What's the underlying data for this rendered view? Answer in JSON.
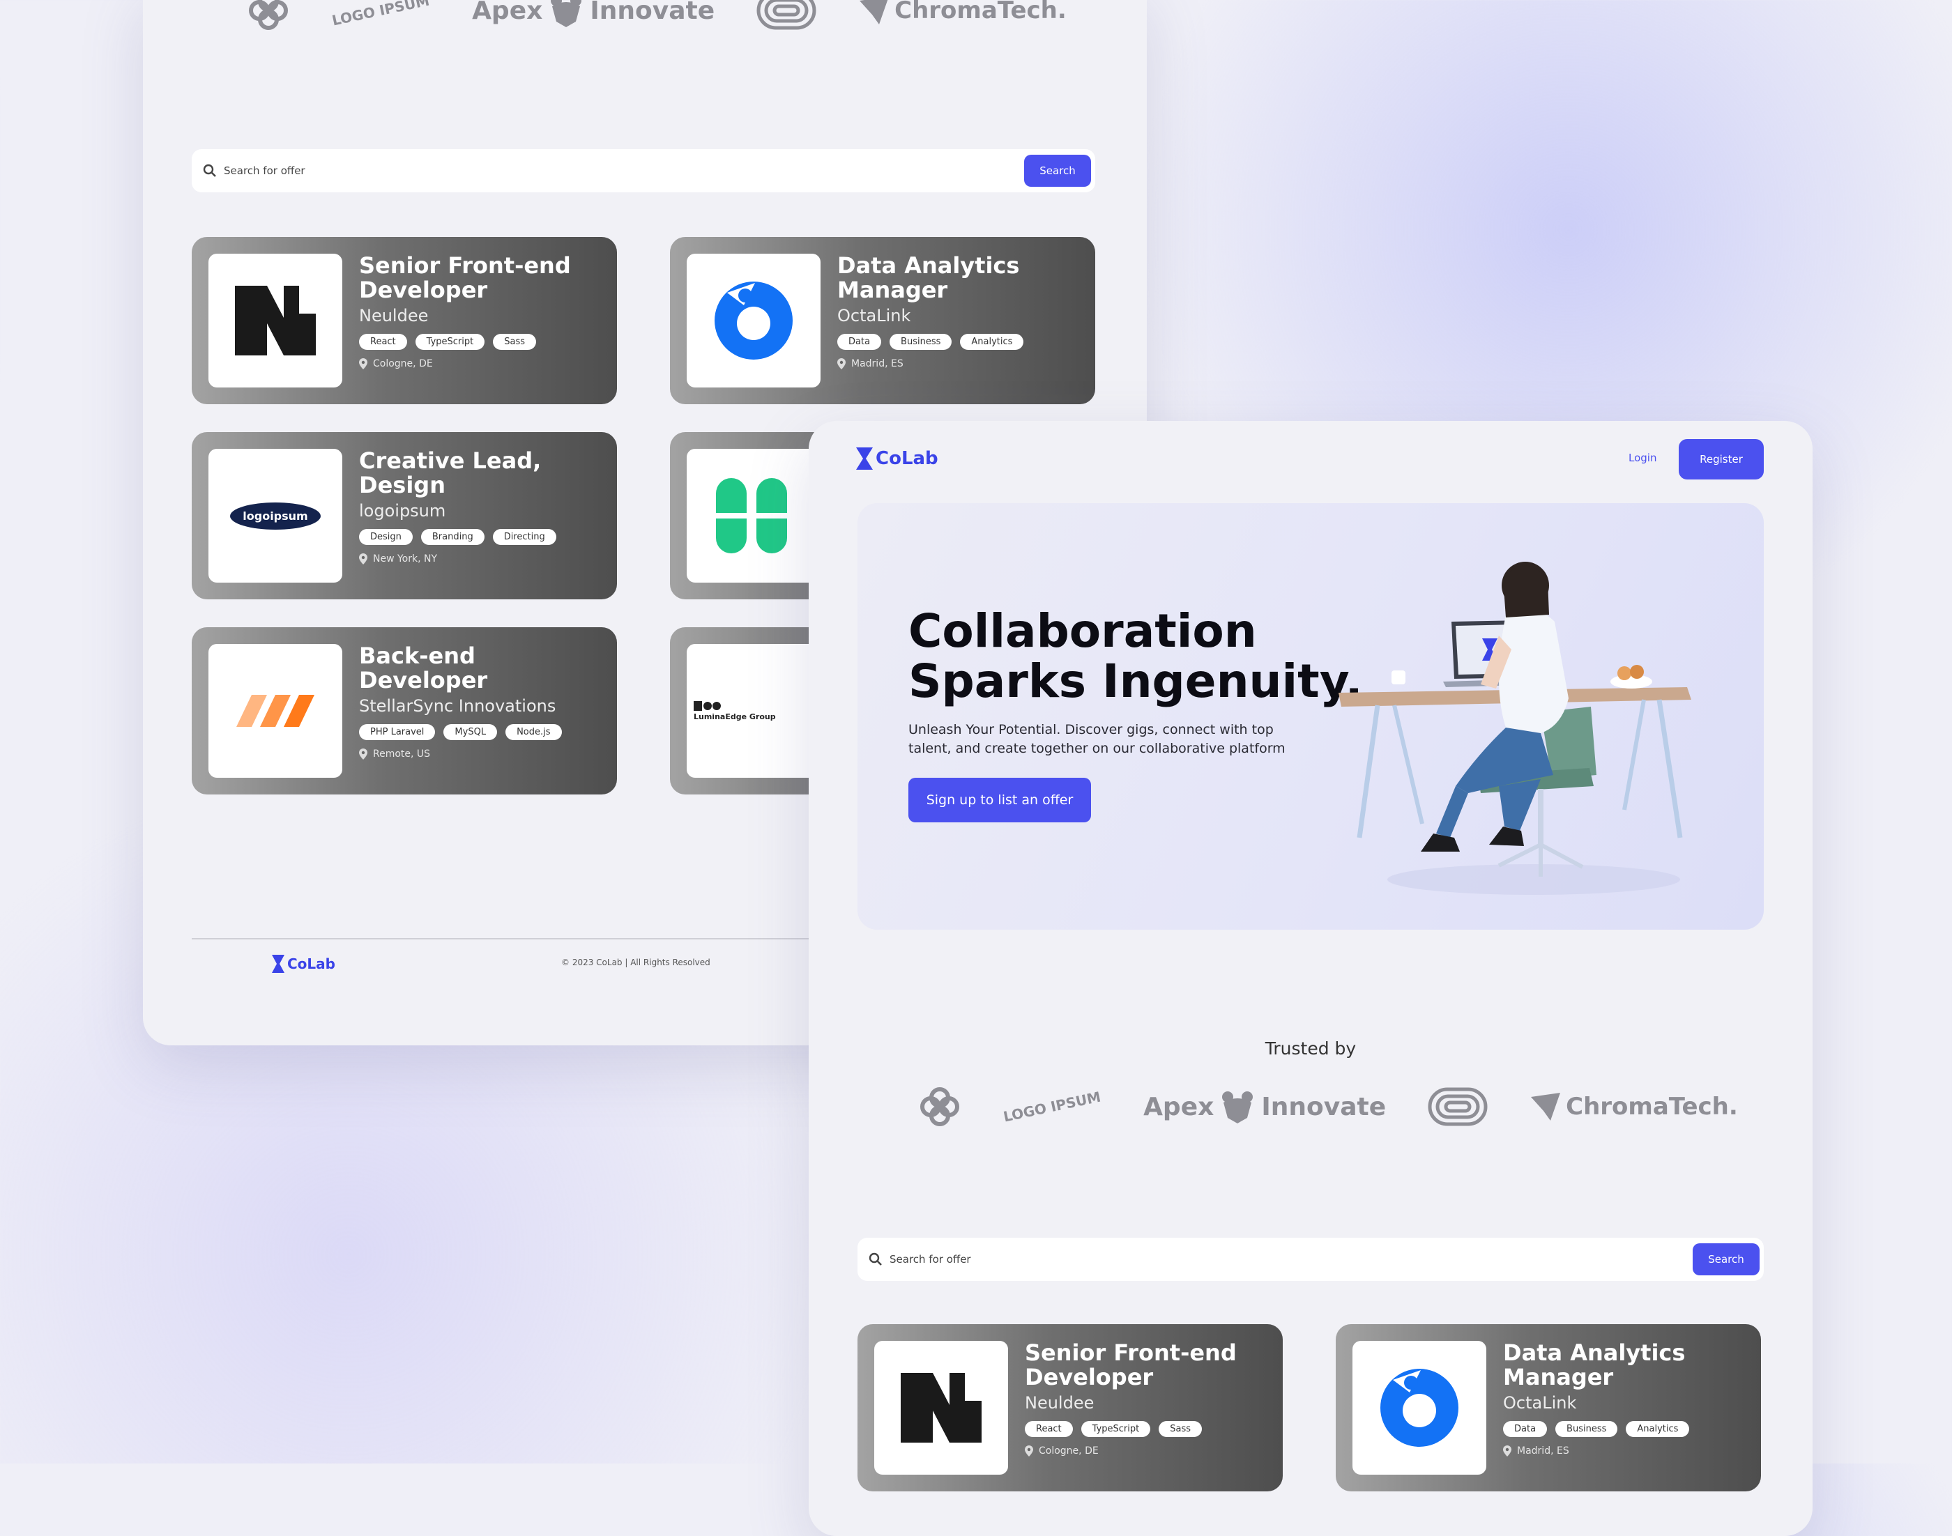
{
  "brand": {
    "name": "CoLab",
    "accent": "#4b51ef"
  },
  "trusted_logos": [
    {
      "name": "logo-4-petal",
      "text": ""
    },
    {
      "name": "logo-ipsum-badge",
      "text": "LOGO IPSUM"
    },
    {
      "name": "apex-innovate",
      "text_left": "Apex",
      "text_right": "Innovate"
    },
    {
      "name": "logo-loop",
      "text": ""
    },
    {
      "name": "chromatech",
      "text": "ChromaTech."
    }
  ],
  "search": {
    "placeholder": "Search for offer",
    "button": "Search"
  },
  "jobs": [
    {
      "title": "Senior Front-end Developer",
      "company": "Neuldee",
      "tags": [
        "React",
        "TypeScript",
        "Sass"
      ],
      "location": "Cologne, DE",
      "logo": "neuldee-logo"
    },
    {
      "title": "Data Analytics Manager",
      "company": "OctaLink",
      "tags": [
        "Data",
        "Business",
        "Analytics"
      ],
      "location": "Madrid, ES",
      "logo": "octalink-logo"
    },
    {
      "title": "Creative Lead, Design",
      "company": "logoipsum",
      "tags": [
        "Design",
        "Branding",
        "Directing"
      ],
      "location": "New York, NY",
      "logo": "logoipsum-logo",
      "logo_text": "logoipsum"
    },
    {
      "title": "",
      "company": "",
      "tags": [],
      "location": "",
      "logo": "green-clover-logo"
    },
    {
      "title": "Back-end Developer",
      "company": "StellarSync Innovations",
      "tags": [
        "PHP Laravel",
        "MySQL",
        "Node.js"
      ],
      "location": "Remote, US",
      "logo": "stellarsync-logo"
    },
    {
      "title": "",
      "company": "",
      "tags": [],
      "location": "",
      "logo": "luminaedge-logo",
      "logo_text": "LuminaEdge Group"
    }
  ],
  "footer": {
    "copyright": "© 2023 CoLab | All Rights Resolved"
  },
  "nav": {
    "login": "Login",
    "register": "Register"
  },
  "hero": {
    "title_line1": "Collaboration",
    "title_line2": "Sparks Ingenuity.",
    "subtitle": "Unleash Your Potential. Discover gigs, connect with top talent, and create together on our collaborative platform",
    "cta": "Sign up to list an offer"
  },
  "trusted": {
    "label": "Trusted by"
  }
}
